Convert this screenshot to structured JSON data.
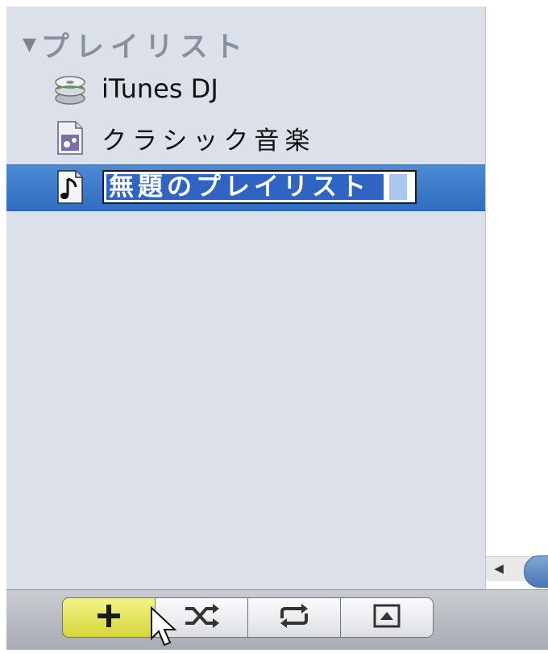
{
  "sidebar": {
    "section_header": "プレイリスト",
    "items": [
      {
        "label": "iTunes DJ",
        "icon": "itunes-dj-icon"
      },
      {
        "label": "クラシック音楽",
        "icon": "smart-playlist-icon"
      },
      {
        "label": "無題のプレイリスト",
        "icon": "playlist-note-icon",
        "editing": true
      }
    ]
  },
  "toolbar": {
    "buttons": [
      {
        "name": "add-playlist",
        "icon": "plus-icon"
      },
      {
        "name": "shuffle",
        "icon": "shuffle-icon"
      },
      {
        "name": "repeat",
        "icon": "repeat-icon"
      },
      {
        "name": "show-artwork",
        "icon": "artwork-icon"
      }
    ]
  },
  "colors": {
    "sidebar_bg": "#dbe0e9",
    "selection": "#2f6ec2",
    "add_button": "#e6e65a"
  }
}
